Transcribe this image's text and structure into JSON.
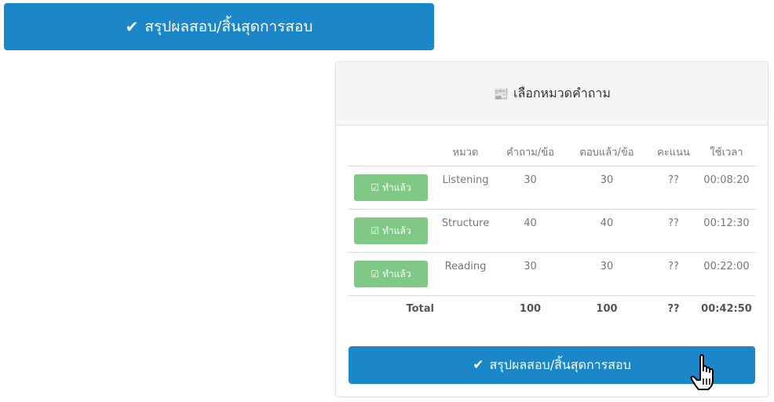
{
  "top_button": {
    "icon": "check-icon",
    "label": "สรุปผลสอบ/สิ้นสุดการสอบ"
  },
  "panel": {
    "icon": "newspaper-icon",
    "title": "เลือกหมวดคำถาม"
  },
  "table": {
    "headers": [
      "",
      "หมวด",
      "คำถาม/ข้อ",
      "ตอบแล้ว/ข้อ",
      "คะแนน",
      "ใช้เวลา"
    ],
    "rows": [
      {
        "status": "ทำแล้ว",
        "category": "Listening",
        "questions": "30",
        "answered": "30",
        "score": "??",
        "time": "00:08:20"
      },
      {
        "status": "ทำแล้ว",
        "category": "Structure",
        "questions": "40",
        "answered": "40",
        "score": "??",
        "time": "00:12:30"
      },
      {
        "status": "ทำแล้ว",
        "category": "Reading",
        "questions": "30",
        "answered": "30",
        "score": "??",
        "time": "00:22:00"
      }
    ],
    "total": {
      "label": "Total",
      "questions": "100",
      "answered": "100",
      "score": "??",
      "time": "00:42:50"
    }
  },
  "bottom_button": {
    "icon": "check-icon",
    "label": "สรุปผลสอบ/สิ้นสุดการสอบ"
  },
  "cursor": {
    "icon": "hand-pointer-icon"
  },
  "colors": {
    "primary": "#1b86c8",
    "success": "#80c985",
    "panel_head": "#f5f5f5"
  }
}
